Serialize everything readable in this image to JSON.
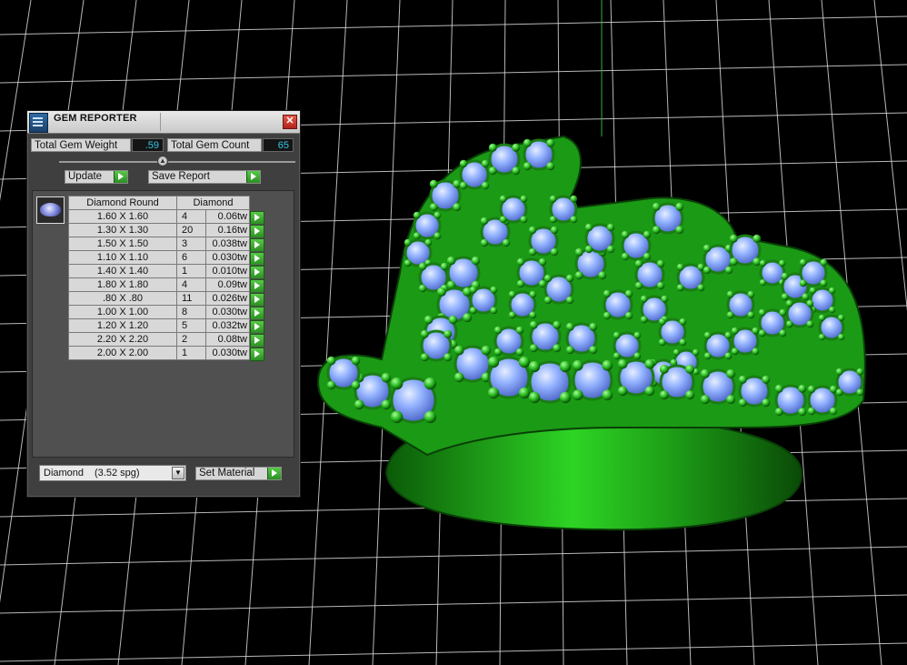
{
  "panel": {
    "title": "GEM REPORTER",
    "close_label": "✕",
    "total_gem_weight_label": "Total Gem Weight",
    "total_gem_weight_value": ".59",
    "total_gem_count_label": "Total Gem Count",
    "total_gem_count_value": "65",
    "update_label": "Update",
    "save_report_label": "Save Report",
    "table": {
      "col_shape": "Diamond Round",
      "col_material": "Diamond",
      "rows": [
        {
          "size": "1.60 X 1.60",
          "count": "4",
          "weight": "0.06tw"
        },
        {
          "size": "1.30 X 1.30",
          "count": "20",
          "weight": "0.16tw"
        },
        {
          "size": "1.50 X 1.50",
          "count": "3",
          "weight": "0.038tw"
        },
        {
          "size": "1.10 X 1.10",
          "count": "6",
          "weight": "0.030tw"
        },
        {
          "size": "1.40 X 1.40",
          "count": "1",
          "weight": "0.010tw"
        },
        {
          "size": "1.80 X 1.80",
          "count": "4",
          "weight": "0.09tw"
        },
        {
          "size": ".80 X .80",
          "count": "11",
          "weight": "0.026tw"
        },
        {
          "size": "1.00 X 1.00",
          "count": "8",
          "weight": "0.030tw"
        },
        {
          "size": "1.20 X 1.20",
          "count": "5",
          "weight": "0.032tw"
        },
        {
          "size": "2.20 X 2.20",
          "count": "2",
          "weight": "0.08tw"
        },
        {
          "size": "2.00 X 2.00",
          "count": "1",
          "weight": "0.030tw"
        }
      ]
    },
    "material_select": {
      "name": "Diamond",
      "spg": "(3.52 spg)"
    },
    "set_material_label": "Set Material"
  },
  "colors": {
    "viewport_bg": "#000000",
    "grid": "#d9d9d9",
    "metal": "#22b81c",
    "gem": "#8fb0ff"
  },
  "icons": [
    "gem-reporter-app-icon",
    "close-icon",
    "slider-knob",
    "play-arrow-icon",
    "round-diamond-icon",
    "dropdown-arrow-icon"
  ]
}
